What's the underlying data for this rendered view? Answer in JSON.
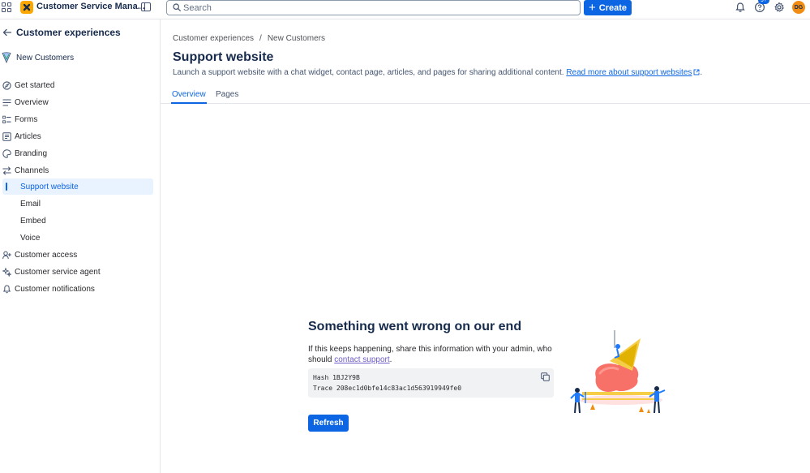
{
  "topbar": {
    "app_title": "Customer Service Mana...",
    "search_placeholder": "Search",
    "create_label": "Create",
    "help_badge": "9+",
    "avatar_initials": "DG"
  },
  "sidebar": {
    "heading": "Customer experiences",
    "project_name": "New Customers",
    "items": [
      {
        "label": "Get started",
        "icon": "compass-icon"
      },
      {
        "label": "Overview",
        "icon": "lines-icon"
      },
      {
        "label": "Forms",
        "icon": "list-icon"
      },
      {
        "label": "Articles",
        "icon": "article-icon"
      },
      {
        "label": "Branding",
        "icon": "palette-icon"
      },
      {
        "label": "Channels",
        "icon": "arrows-swap-icon"
      },
      {
        "label": "Support website",
        "active": true
      },
      {
        "label": "Email"
      },
      {
        "label": "Embed"
      },
      {
        "label": "Voice"
      },
      {
        "label": "Customer access",
        "icon": "person-add-icon"
      },
      {
        "label": "Customer service agent",
        "icon": "sparkle-icon"
      },
      {
        "label": "Customer notifications",
        "icon": "bell-icon"
      }
    ]
  },
  "main": {
    "breadcrumb": [
      "Customer experiences",
      "/",
      "New Customers"
    ],
    "title": "Support website",
    "description": "Launch a support website with a chat widget, contact page, articles, and pages for sharing additional content.",
    "read_more_link": "Read more about support websites",
    "description_end": ".",
    "tabs": [
      "Overview",
      "Pages"
    ]
  },
  "error": {
    "title": "Something went wrong on our end",
    "desc_prefix": "If this keeps happening, share this information with your admin, who should",
    "contact_link": "contact support",
    "desc_suffix": ".",
    "hash_line": "Hash 1BJ2Y9B",
    "trace_line": "Trace 208ec1d0bfe14c83ac1d563919949fe0",
    "refresh_label": "Refresh"
  },
  "colors": {
    "accent": "#0c66e4",
    "app_logo": "#fca700",
    "avatar": "#f18d13"
  }
}
